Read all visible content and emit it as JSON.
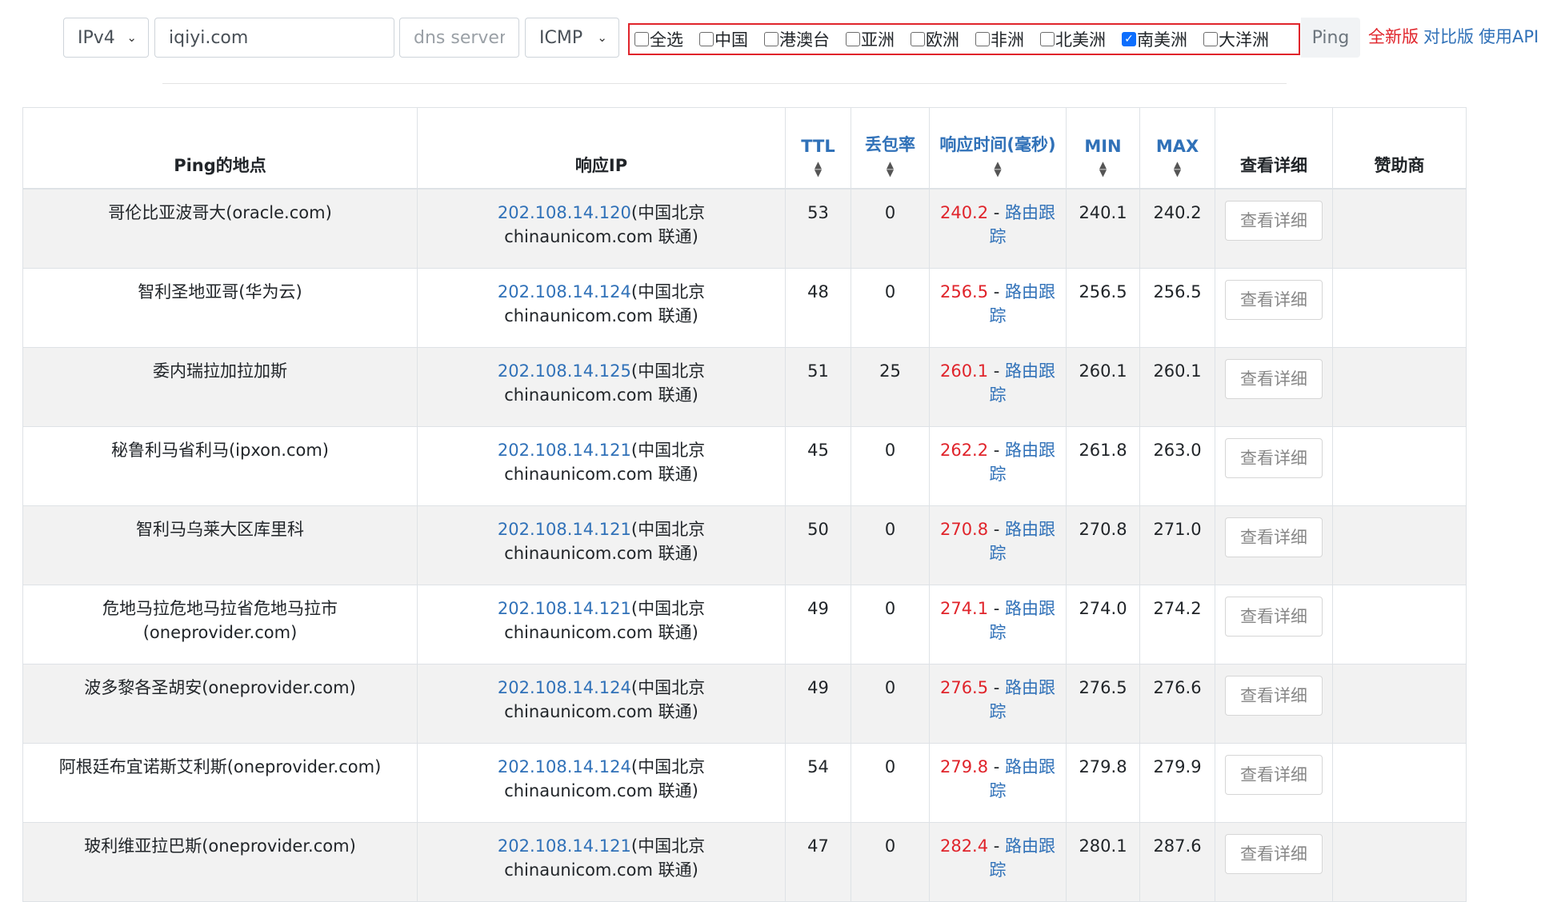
{
  "toolbar": {
    "ip_version": "IPv4",
    "host": "iqiyi.com",
    "dns_placeholder": "dns server",
    "protocol": "ICMP",
    "ping_label": "Ping"
  },
  "regions": [
    {
      "label": "全选",
      "checked": false
    },
    {
      "label": "中国",
      "checked": false
    },
    {
      "label": "港澳台",
      "checked": false
    },
    {
      "label": "亚洲",
      "checked": false
    },
    {
      "label": "欧洲",
      "checked": false
    },
    {
      "label": "非洲",
      "checked": false
    },
    {
      "label": "北美洲",
      "checked": false
    },
    {
      "label": "南美洲",
      "checked": true
    },
    {
      "label": "大洋洲",
      "checked": false
    }
  ],
  "top_links": {
    "full_version": "全新版",
    "compare_version": "对比版",
    "api": "使用API"
  },
  "colors": {
    "link": "#3071b8",
    "alert": "#e0242b",
    "stripe": "#f2f2f2"
  },
  "table": {
    "headers": {
      "location": "Ping的地点",
      "ip": "响应IP",
      "ttl": "TTL",
      "loss": "丢包率",
      "time": "响应时间(毫秒)",
      "min": "MIN",
      "max": "MAX",
      "detail": "查看详细",
      "sponsor": "赞助商"
    },
    "trace_label": "路由跟踪",
    "detail_button": "查看详细",
    "rows": [
      {
        "location": "哥伦比亚波哥大(oracle.com)",
        "ip": "202.108.14.120",
        "ip_info": "(中国北京 chinaunicom.com 联通)",
        "ttl": "53",
        "loss": "0",
        "time": "240.2",
        "min": "240.1",
        "max": "240.2"
      },
      {
        "location": "智利圣地亚哥(华为云)",
        "ip": "202.108.14.124",
        "ip_info": "(中国北京 chinaunicom.com 联通)",
        "ttl": "48",
        "loss": "0",
        "time": "256.5",
        "min": "256.5",
        "max": "256.5"
      },
      {
        "location": "委内瑞拉加拉加斯",
        "ip": "202.108.14.125",
        "ip_info": "(中国北京 chinaunicom.com 联通)",
        "ttl": "51",
        "loss": "25",
        "time": "260.1",
        "min": "260.1",
        "max": "260.1"
      },
      {
        "location": "秘鲁利马省利马(ipxon.com)",
        "ip": "202.108.14.121",
        "ip_info": "(中国北京 chinaunicom.com 联通)",
        "ttl": "45",
        "loss": "0",
        "time": "262.2",
        "min": "261.8",
        "max": "263.0"
      },
      {
        "location": "智利马乌莱大区库里科",
        "ip": "202.108.14.121",
        "ip_info": "(中国北京 chinaunicom.com 联通)",
        "ttl": "50",
        "loss": "0",
        "time": "270.8",
        "min": "270.8",
        "max": "271.0"
      },
      {
        "location": "危地马拉危地马拉省危地马拉市(oneprovider.com)",
        "ip": "202.108.14.121",
        "ip_info": "(中国北京 chinaunicom.com 联通)",
        "ttl": "49",
        "loss": "0",
        "time": "274.1",
        "min": "274.0",
        "max": "274.2"
      },
      {
        "location": "波多黎各圣胡安(oneprovider.com)",
        "ip": "202.108.14.124",
        "ip_info": "(中国北京 chinaunicom.com 联通)",
        "ttl": "49",
        "loss": "0",
        "time": "276.5",
        "min": "276.5",
        "max": "276.6"
      },
      {
        "location": "阿根廷布宜诺斯艾利斯(oneprovider.com)",
        "ip": "202.108.14.124",
        "ip_info": "(中国北京 chinaunicom.com 联通)",
        "ttl": "54",
        "loss": "0",
        "time": "279.8",
        "min": "279.8",
        "max": "279.9"
      },
      {
        "location": "玻利维亚拉巴斯(oneprovider.com)",
        "ip": "202.108.14.121",
        "ip_info": "(中国北京 chinaunicom.com 联通)",
        "ttl": "47",
        "loss": "0",
        "time": "282.4",
        "min": "280.1",
        "max": "287.6"
      }
    ]
  }
}
